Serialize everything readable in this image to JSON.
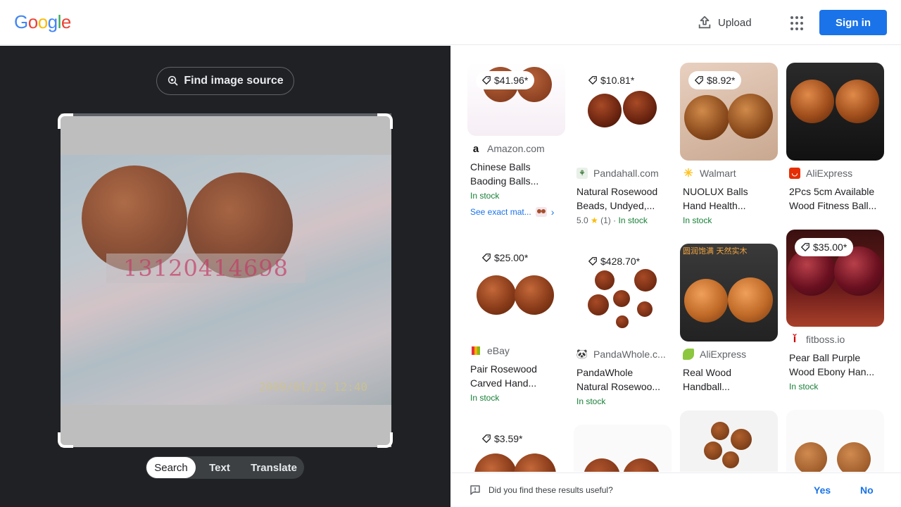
{
  "header": {
    "logo_letters": [
      {
        "char": "G",
        "color": "#4285f4"
      },
      {
        "char": "o",
        "color": "#ea4335"
      },
      {
        "char": "o",
        "color": "#fbbc05"
      },
      {
        "char": "g",
        "color": "#4285f4"
      },
      {
        "char": "l",
        "color": "#34a853"
      },
      {
        "char": "e",
        "color": "#ea4335"
      }
    ],
    "upload_label": "Upload",
    "upload_icon": "upload-icon",
    "apps_icon": "apps-grid-icon",
    "signin_label": "Sign in"
  },
  "left_panel": {
    "find_source_label": "Find image source",
    "find_source_icon": "lens-search-icon",
    "image": {
      "watermark_text": "13120414698",
      "date_stamp": "2009/01/12 12:40"
    },
    "modes": [
      {
        "label": "Search",
        "active": true
      },
      {
        "label": "Text",
        "active": false
      },
      {
        "label": "Translate",
        "active": false
      }
    ]
  },
  "results": [
    {
      "price": "$41.96*",
      "source": "Amazon.com",
      "favicon": "amazon-icon",
      "title_lines": [
        "Chinese Balls",
        "Baoding Balls..."
      ],
      "stock": "In stock",
      "exact_match": "See exact mat..."
    },
    {
      "price": "$10.81*",
      "source": "Pandahall.com",
      "favicon": "pandahall-icon",
      "title_lines": [
        "Natural Rosewood",
        "Beads, Undyed,..."
      ],
      "rating": "5.0",
      "rating_count": "(1)",
      "stock": "In stock"
    },
    {
      "price": "$8.92*",
      "source": "Walmart",
      "favicon": "walmart-icon",
      "title_lines": [
        "NUOLUX Balls",
        "Hand Health..."
      ],
      "stock": "In stock"
    },
    {
      "price": "",
      "source": "AliExpress",
      "favicon": "aliexpress-icon",
      "title_lines": [
        "2Pcs 5cm Available",
        "Wood Fitness Ball..."
      ],
      "stock": ""
    },
    {
      "price": "$25.00*",
      "source": "eBay",
      "favicon": "ebay-icon",
      "title_lines": [
        "Pair Rosewood",
        "Carved Hand..."
      ],
      "stock": "In stock"
    },
    {
      "price": "$428.70*",
      "source": "PandaWhole.c...",
      "favicon": "pandawhole-icon",
      "title_lines": [
        "PandaWhole",
        "Natural Rosewoo..."
      ],
      "stock": "In stock"
    },
    {
      "price": "",
      "source": "AliExpress",
      "favicon": "aliexpress-green-icon",
      "title_lines": [
        "Real Wood",
        "Handball..."
      ],
      "stock": "",
      "overlay_text": "圆润饱满 天然实木"
    },
    {
      "price": "$35.00*",
      "source": "fitboss.io",
      "favicon": "fitboss-icon",
      "title_lines": [
        "Pear Ball Purple",
        "Wood Ebony Han..."
      ],
      "stock": "In stock"
    },
    {
      "price": "$3.59*",
      "source": "",
      "title_lines": [],
      "stock": ""
    },
    {
      "price": "",
      "source": "",
      "title_lines": [],
      "stock": ""
    },
    {
      "price": "",
      "source": "",
      "title_lines": [],
      "stock": ""
    },
    {
      "price": "",
      "source": "",
      "title_lines": [],
      "stock": ""
    }
  ],
  "feedback": {
    "question": "Did you find these results useful?",
    "yes_label": "Yes",
    "no_label": "No"
  }
}
